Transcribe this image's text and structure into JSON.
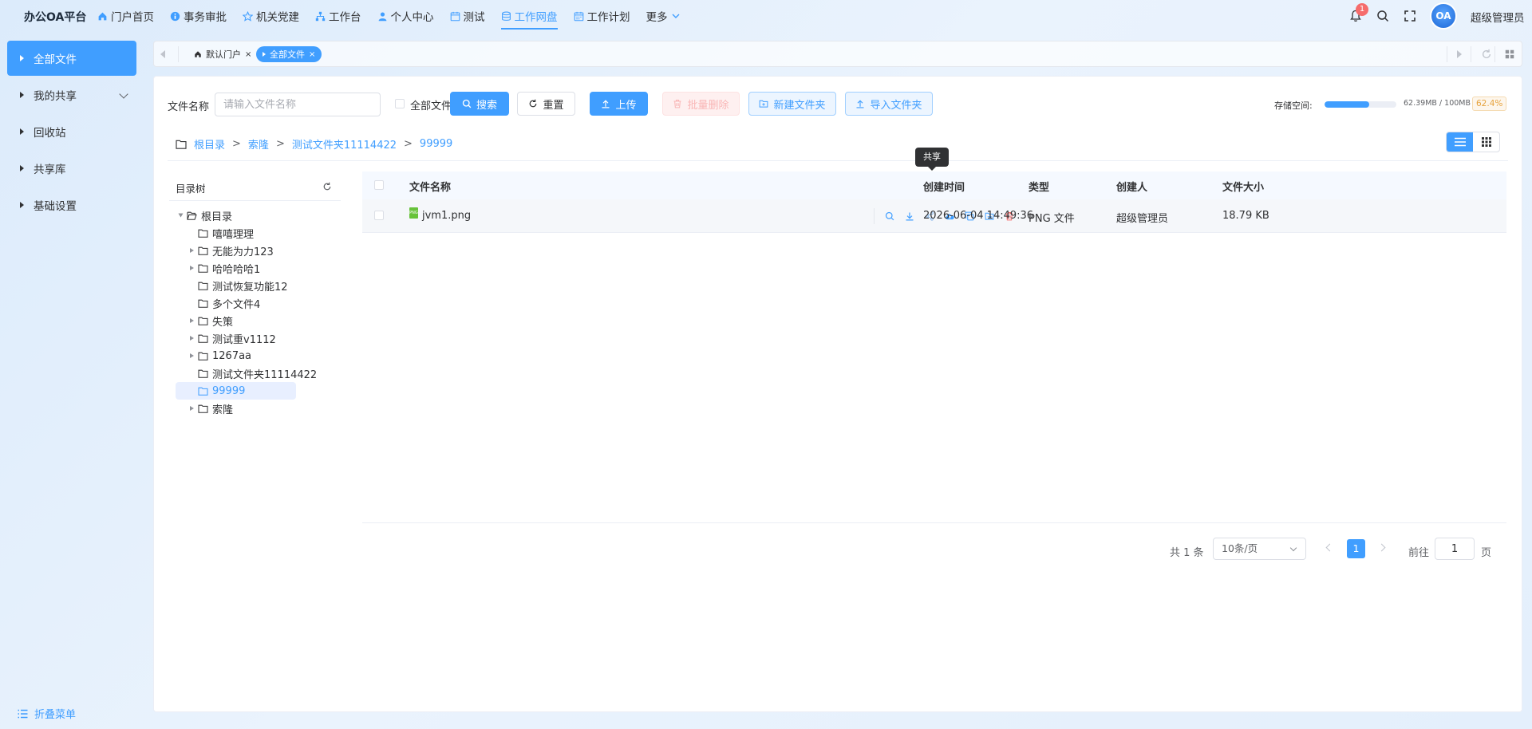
{
  "app": {
    "brand": "办公OA平台"
  },
  "nav": [
    {
      "label": "门户首页",
      "icon": "home-icon",
      "active": false
    },
    {
      "label": "事务审批",
      "icon": "info-icon",
      "active": false
    },
    {
      "label": "机关党建",
      "icon": "star-icon",
      "active": false
    },
    {
      "label": "工作台",
      "icon": "org-chart-icon",
      "active": false
    },
    {
      "label": "个人中心",
      "icon": "user-icon",
      "active": false
    },
    {
      "label": "测试",
      "icon": "calendar-icon",
      "active": false
    },
    {
      "label": "工作网盘",
      "icon": "database-icon",
      "active": true
    },
    {
      "label": "工作计划",
      "icon": "calendar-icon",
      "active": false
    }
  ],
  "nav_more": "更多",
  "header": {
    "notification_count": "1",
    "avatar_text": "OA",
    "user_name": "超级管理员"
  },
  "sidebar": {
    "items": [
      {
        "label": "全部文件",
        "active": true
      },
      {
        "label": "我的共享",
        "active": false,
        "expandable": true
      },
      {
        "label": "回收站",
        "active": false
      },
      {
        "label": "共享库",
        "active": false
      },
      {
        "label": "基础设置",
        "active": false
      }
    ],
    "collapse_label": "折叠菜单"
  },
  "tabs": [
    {
      "label": "默认门户",
      "close": "×",
      "icon": "home-icon"
    },
    {
      "label": "全部文件",
      "close": "×",
      "active": true
    }
  ],
  "toolbar": {
    "filename_label": "文件名称",
    "search_placeholder": "请输入文件名称",
    "all_files_label": "全部文件",
    "search_btn": "搜索",
    "reset_btn": "重置",
    "upload_btn": "上传",
    "batch_delete_btn": "批量删除",
    "new_folder_btn": "新建文件夹",
    "import_folder_btn": "导入文件夹"
  },
  "storage": {
    "label": "存储空间:",
    "used_text": "62.39MB / 100MB",
    "percent_text": "62.4%",
    "percent": 62.4
  },
  "breadcrumb": [
    "根目录",
    "索隆",
    "测试文件夹11114422",
    "99999"
  ],
  "breadcrumb_sep": ">",
  "tree": {
    "title": "目录树",
    "nodes": [
      {
        "label": "根目录",
        "level": 0,
        "toggle": "open"
      },
      {
        "label": "嘻嘻理理",
        "level": 1,
        "toggle": "none"
      },
      {
        "label": "无能为力123",
        "level": 1,
        "toggle": "closed"
      },
      {
        "label": "哈哈哈哈1",
        "level": 1,
        "toggle": "closed"
      },
      {
        "label": "测试恢复功能12",
        "level": 1,
        "toggle": "none"
      },
      {
        "label": "多个文件4",
        "level": 1,
        "toggle": "none"
      },
      {
        "label": "失策",
        "level": 1,
        "toggle": "closed"
      },
      {
        "label": "测试重v1112",
        "level": 1,
        "toggle": "closed"
      },
      {
        "label": "1267aa",
        "level": 1,
        "toggle": "closed"
      },
      {
        "label": "测试文件夹11114422",
        "level": 1,
        "toggle": "none"
      },
      {
        "label": "99999",
        "level": 1,
        "toggle": "none",
        "selected": true
      },
      {
        "label": "索隆",
        "level": 1,
        "toggle": "closed"
      }
    ]
  },
  "table": {
    "headers": {
      "name": "文件名称",
      "created": "创建时间",
      "type": "类型",
      "creator": "创建人",
      "size": "文件大小"
    },
    "rows": [
      {
        "name": "jvm1.png",
        "badge": "PNG",
        "created": "2026-06-04 14:49:36",
        "type": "PNG 文件",
        "creator": "超级管理员",
        "size": "18.79 KB"
      }
    ],
    "tooltip": "共享"
  },
  "pagination": {
    "total": "共 1 条",
    "page_size": "10条/页",
    "current": "1",
    "goto_label": "前往",
    "goto_value": "1",
    "unit": "页"
  },
  "colors": {
    "primary": "#409eff",
    "danger": "#f56c6c",
    "warning": "#e6a23c"
  }
}
